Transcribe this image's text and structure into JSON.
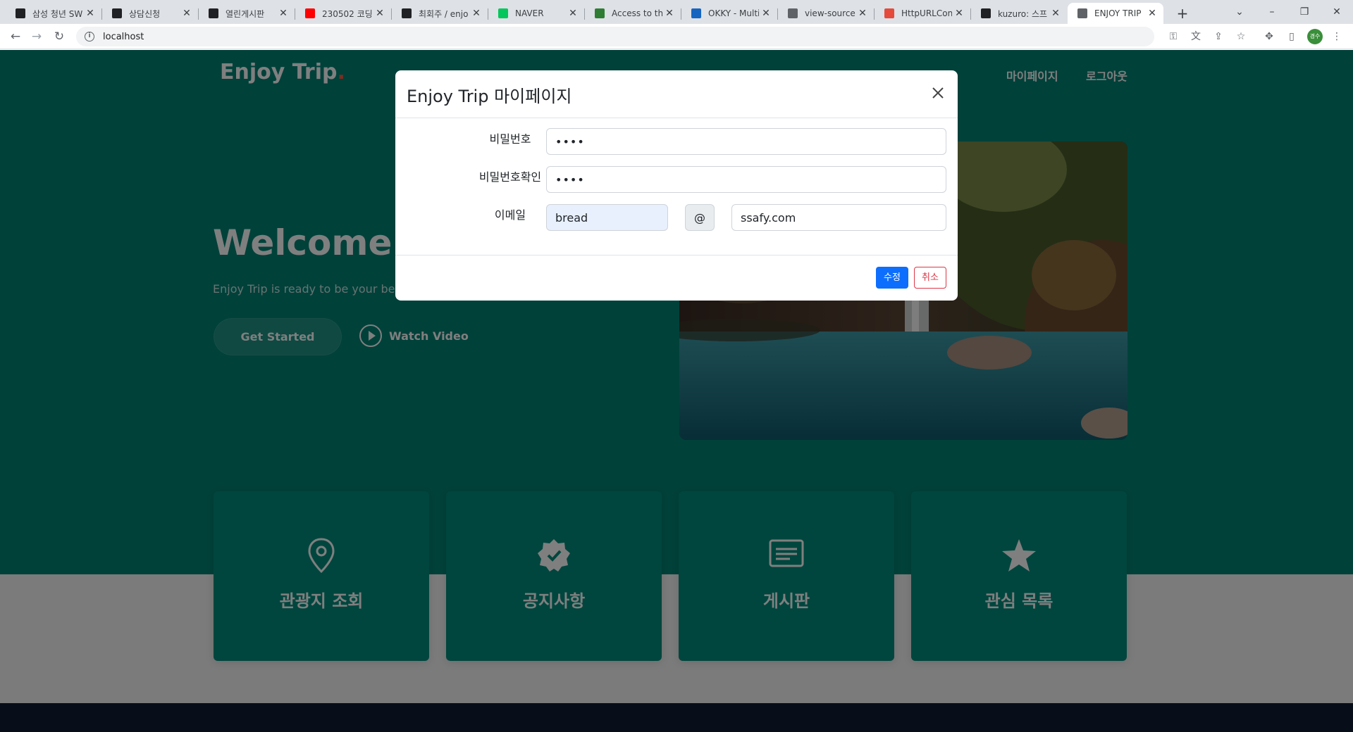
{
  "browser": {
    "tabs": [
      {
        "label": "삼성 청년 SW",
        "favicon_color": "#202124"
      },
      {
        "label": "상담신청",
        "favicon_color": "#202124"
      },
      {
        "label": "열린게시판",
        "favicon_color": "#202124"
      },
      {
        "label": "230502 코딩",
        "favicon_color": "#ff0000"
      },
      {
        "label": "최회주 / enjo",
        "favicon_color": "#202124"
      },
      {
        "label": "NAVER",
        "favicon_color": "#03c75a"
      },
      {
        "label": "Access to the",
        "favicon_color": "#2e7d32"
      },
      {
        "label": "OKKY - Multi",
        "favicon_color": "#1565c0"
      },
      {
        "label": "view-source:",
        "favicon_color": "#5f6368"
      },
      {
        "label": "HttpURLConn",
        "favicon_color": "#e64a3b"
      },
      {
        "label": "kuzuro: 스프",
        "favicon_color": "#202124"
      },
      {
        "label": "ENJOY TRIP",
        "favicon_color": "#5f6368"
      }
    ],
    "url": "localhost",
    "profile_initials": "경수"
  },
  "site": {
    "logo_text": "Enjoy Trip",
    "logo_dot": ".",
    "nav": [
      "마이페이지",
      "로그아웃"
    ],
    "hero_title": "Welcome to Enjoy Trip",
    "hero_subtitle": "Enjoy Trip is ready to be your best travel partner",
    "get_started": "Get Started",
    "watch_video": "Watch Video",
    "cards": [
      {
        "title": "관광지 조회",
        "icon": "map-pin-icon"
      },
      {
        "title": "공지사항",
        "icon": "verified-badge-icon"
      },
      {
        "title": "게시판",
        "icon": "board-icon"
      },
      {
        "title": "관심 목록",
        "icon": "star-icon"
      }
    ],
    "colors": {
      "primary": "#008374",
      "card": "#008d7d",
      "accent": "#f85a40"
    }
  },
  "modal": {
    "title": "Enjoy Trip 마이페이지",
    "fields": {
      "password_label": "비밀번호",
      "password_value": "••••",
      "password_confirm_label": "비밀번호확인",
      "password_confirm_value": "••••",
      "email_label": "이메일",
      "email_id": "bread",
      "email_at": "@",
      "email_domain": "ssafy.com"
    },
    "edit_button": "수정",
    "cancel_button": "취소"
  }
}
